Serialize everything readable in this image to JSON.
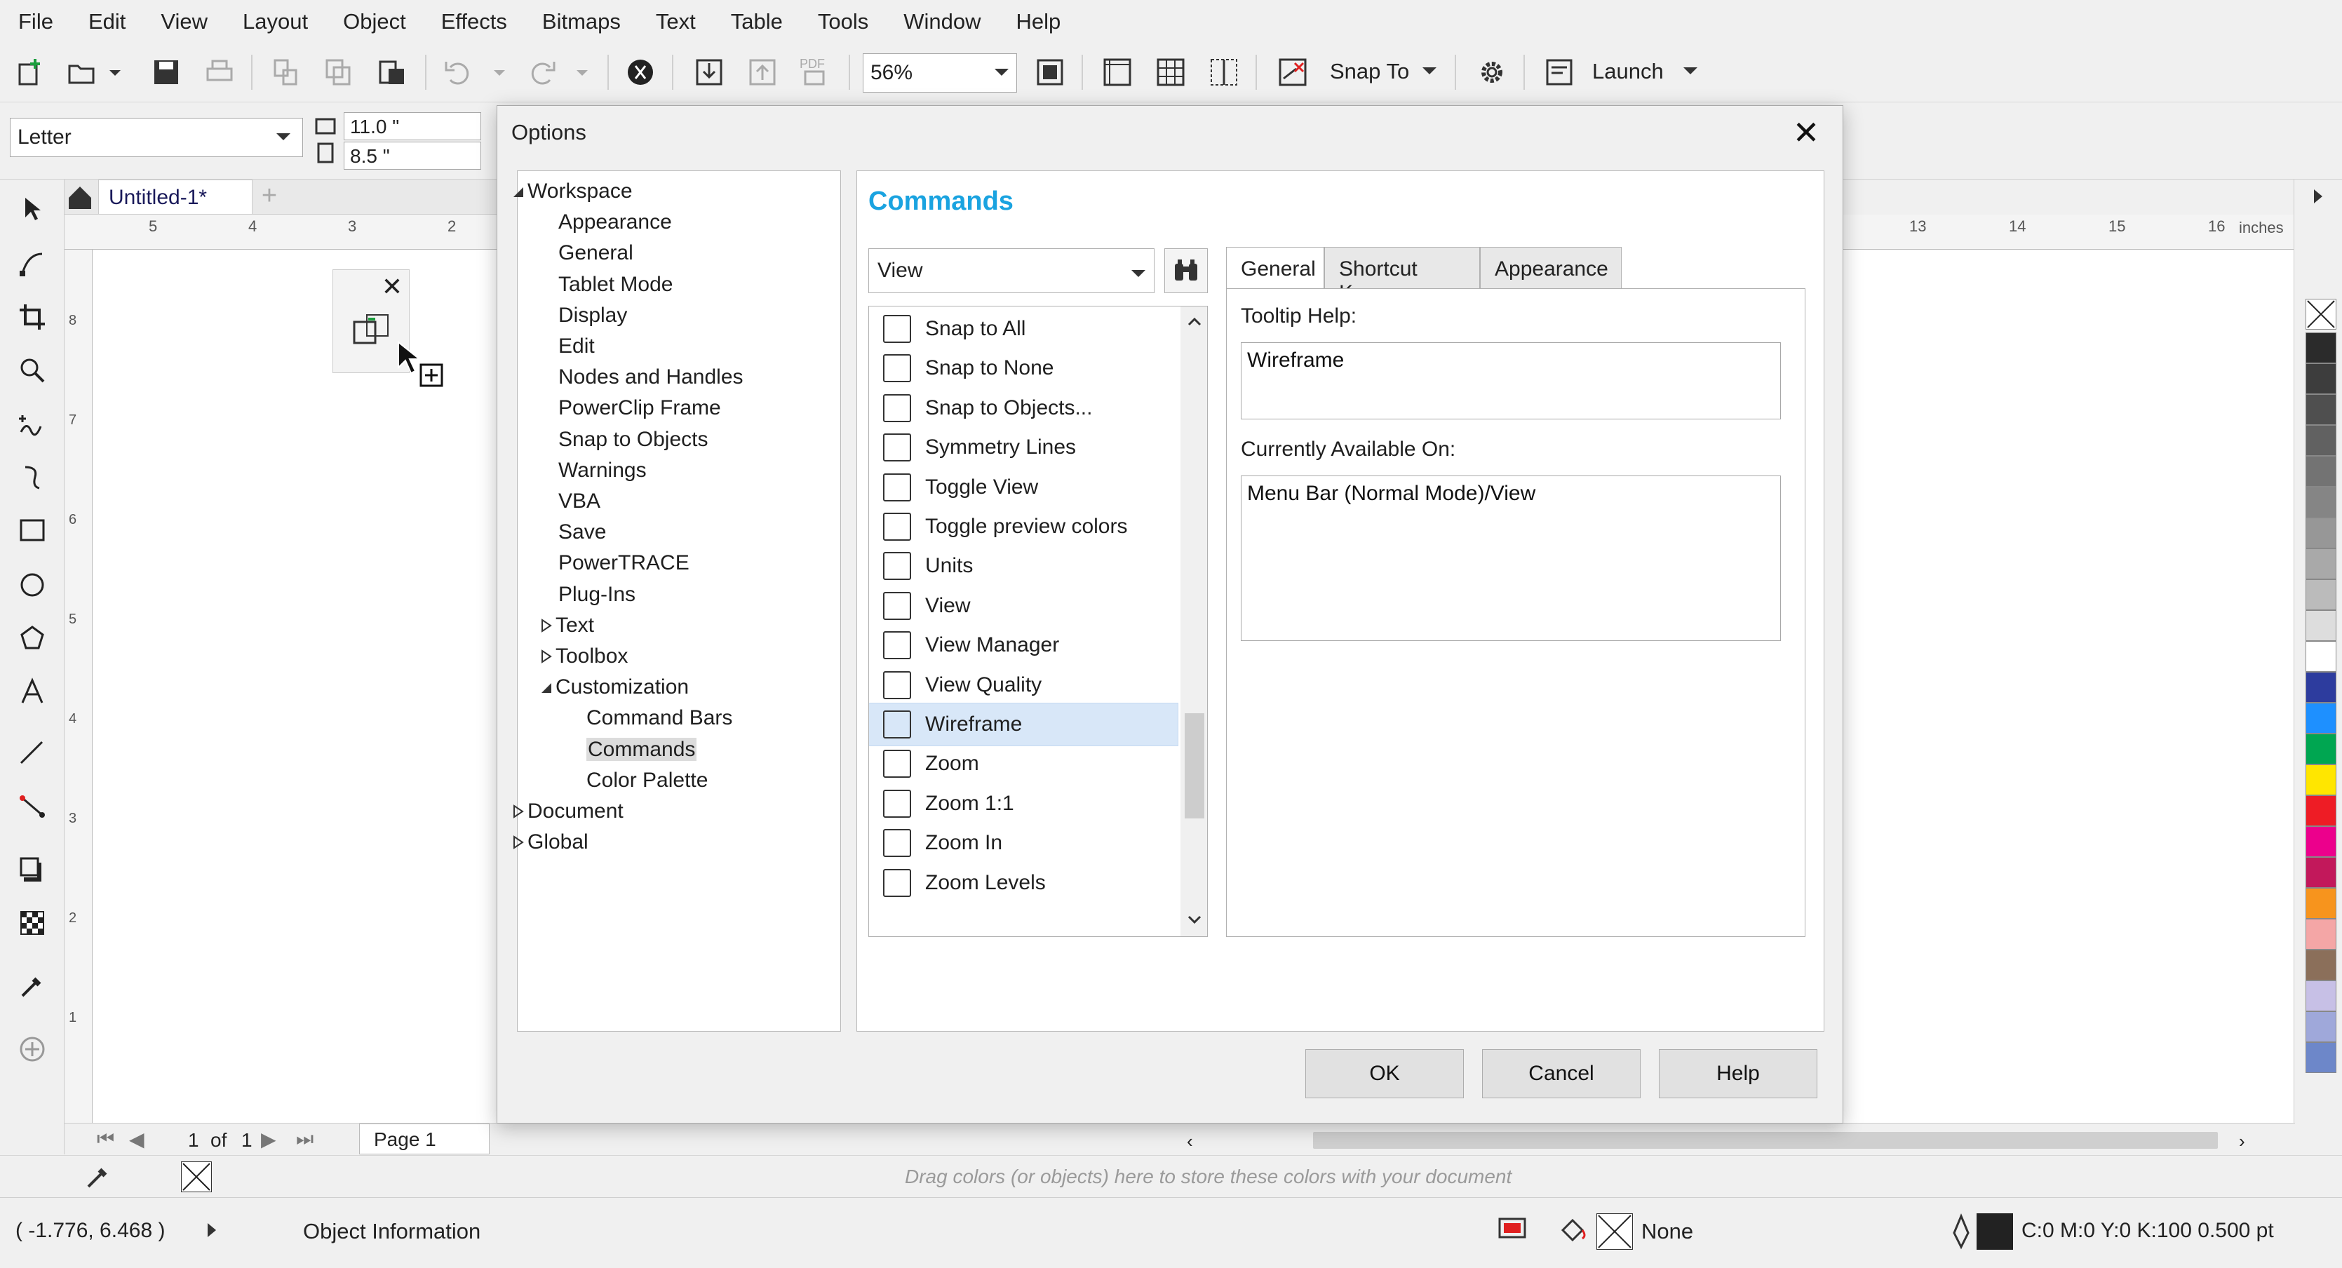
{
  "menu": [
    "File",
    "Edit",
    "View",
    "Layout",
    "Object",
    "Effects",
    "Bitmaps",
    "Text",
    "Table",
    "Tools",
    "Window",
    "Help"
  ],
  "toolbar": {
    "zoom": "56%",
    "snap_to": "Snap To",
    "launch": "Launch",
    "pdf": "PDF"
  },
  "propbar": {
    "paper": "Letter",
    "width": "11.0 \"",
    "height": "8.5 \""
  },
  "doc_tab": {
    "name": "Untitled-1*",
    "add": "+"
  },
  "ruler": {
    "top_left": [
      "5",
      "4",
      "3",
      "2"
    ],
    "top_right": [
      "13",
      "14",
      "15",
      "16"
    ],
    "units": "inches",
    "left": [
      "8",
      "7",
      "6",
      "5",
      "4",
      "3",
      "2",
      "1"
    ]
  },
  "pagebar": {
    "current": "1",
    "of": "of",
    "total": "1",
    "page_tab": "Page 1"
  },
  "colordock": {
    "hint": "Drag colors (or objects) here to store these colors with your document"
  },
  "status": {
    "coords": "( -1.776, 6.468 )",
    "object_info": "Object Information",
    "fill": "None",
    "outline": "C:0 M:0 Y:0 K:100  0.500 pt"
  },
  "dialog": {
    "title": "Options",
    "heading": "Commands",
    "tree": [
      {
        "label": "Workspace",
        "level": 0,
        "exp": "open"
      },
      {
        "label": "Appearance",
        "level": 1
      },
      {
        "label": "General",
        "level": 1
      },
      {
        "label": "Tablet Mode",
        "level": 1
      },
      {
        "label": "Display",
        "level": 1
      },
      {
        "label": "Edit",
        "level": 1
      },
      {
        "label": "Nodes and Handles",
        "level": 1
      },
      {
        "label": "PowerClip Frame",
        "level": 1
      },
      {
        "label": "Snap to Objects",
        "level": 1
      },
      {
        "label": "Warnings",
        "level": 1
      },
      {
        "label": "VBA",
        "level": 1
      },
      {
        "label": "Save",
        "level": 1
      },
      {
        "label": "PowerTRACE",
        "level": 1
      },
      {
        "label": "Plug-Ins",
        "level": 1
      },
      {
        "label": "Text",
        "level": 1,
        "exp": "closed"
      },
      {
        "label": "Toolbox",
        "level": 1,
        "exp": "closed"
      },
      {
        "label": "Customization",
        "level": 1,
        "exp": "open"
      },
      {
        "label": "Command Bars",
        "level": 2
      },
      {
        "label": "Commands",
        "level": 2,
        "selected": true
      },
      {
        "label": "Color Palette",
        "level": 2
      },
      {
        "label": "Document",
        "level": 0,
        "exp": "closed"
      },
      {
        "label": "Global",
        "level": 0,
        "exp": "closed"
      }
    ],
    "category": "View",
    "commands": [
      {
        "label": "Snap to All",
        "icon": "snap-to-all-icon"
      },
      {
        "label": "Snap to None",
        "icon": "snap-to-none-icon"
      },
      {
        "label": "Snap to Objects...",
        "icon": "snap-to-objects-icon"
      },
      {
        "label": "Symmetry Lines",
        "icon": "symmetry-lines-icon"
      },
      {
        "label": "Toggle View",
        "icon": "toggle-view-icon"
      },
      {
        "label": "Toggle preview colors",
        "icon": "toggle-preview-colors-icon"
      },
      {
        "label": "Units",
        "icon": "units-icon"
      },
      {
        "label": "View",
        "icon": "view-icon"
      },
      {
        "label": "View Manager",
        "icon": "view-manager-icon"
      },
      {
        "label": "View Quality",
        "icon": "view-quality-icon"
      },
      {
        "label": "Wireframe",
        "icon": "wireframe-icon",
        "selected": true
      },
      {
        "label": "Zoom",
        "icon": "zoom-icon"
      },
      {
        "label": "Zoom 1:1",
        "icon": "zoom-1-1-icon"
      },
      {
        "label": "Zoom In",
        "icon": "zoom-in-icon"
      },
      {
        "label": "Zoom Levels",
        "icon": "zoom-levels-icon"
      }
    ],
    "tabs": [
      "General",
      "Shortcut Keys",
      "Appearance"
    ],
    "tooltip_label": "Tooltip Help:",
    "tooltip_value": "Wireframe",
    "available_label": "Currently Available On:",
    "available_value": "Menu Bar (Normal Mode)/View",
    "buttons": {
      "ok": "OK",
      "cancel": "Cancel",
      "help": "Help"
    }
  },
  "palette_colors": [
    "#2b2b2b",
    "#3d3d3d",
    "#4f4f4f",
    "#616161",
    "#737373",
    "#858585",
    "#979797",
    "#a9a9a9",
    "#bbbbbb",
    "#dddddd",
    "#ffffff",
    "#2d3c9e",
    "#1e90ff",
    "#00a651",
    "#ffe600",
    "#ee1c25",
    "#ec008c",
    "#c2185b",
    "#f7941d",
    "#f4a6a6",
    "#8b6f5a",
    "#c7c0e6",
    "#9fa8da",
    "#6d87c9"
  ],
  "colors": {
    "accent": "#1aa3e0",
    "selection": "#d8e7f8"
  }
}
